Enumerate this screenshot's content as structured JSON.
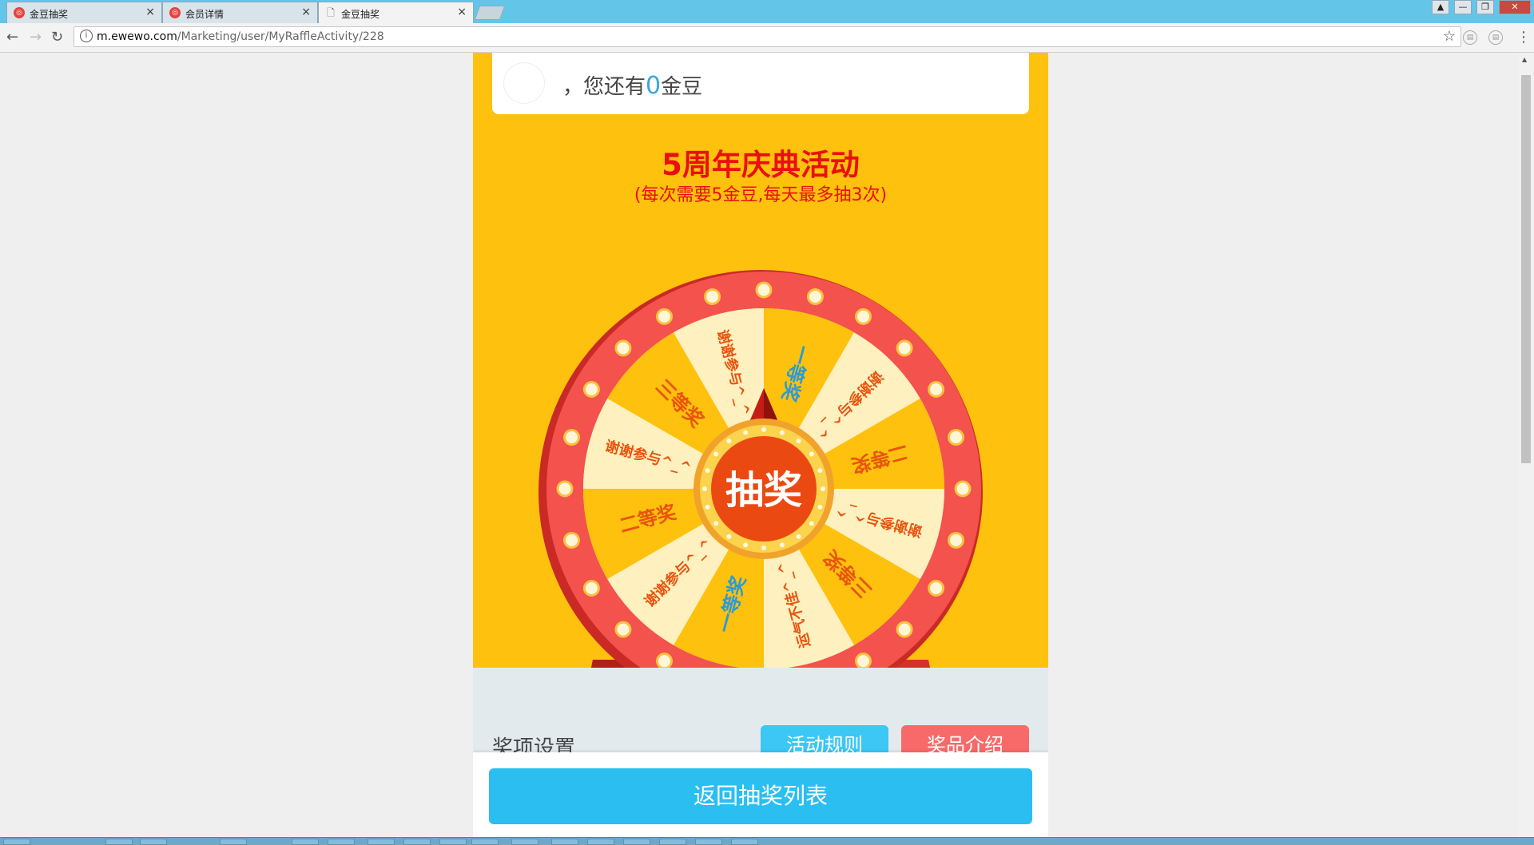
{
  "browser": {
    "tabs": [
      {
        "title": "金豆抽奖",
        "active": false
      },
      {
        "title": "会员详情",
        "active": false
      },
      {
        "title": "金豆抽奖",
        "active": true
      }
    ],
    "close_glyph": "×",
    "url_host": "m.ewewo.com",
    "url_path": "/Marketing/user/MyRaffleActivity/228"
  },
  "user": {
    "prefix": "，您还有",
    "beans": "0",
    "suffix": "金豆"
  },
  "activity": {
    "title": "5周年庆典活动",
    "subtitle": "(每次需要5金豆,每天最多抽3次)"
  },
  "wheel": {
    "center_label": "抽奖",
    "segments": [
      {
        "label": "一等奖",
        "color": "#2b9ad8"
      },
      {
        "label": "谢谢参与^_^",
        "color": "#e8540e"
      },
      {
        "label": "二等奖",
        "color": "#e8540e"
      },
      {
        "label": "谢谢参与^_^",
        "color": "#e8540e"
      },
      {
        "label": "三等奖",
        "color": "#e8540e"
      },
      {
        "label": "运气不佳^_^",
        "color": "#e8540e"
      },
      {
        "label": "一等奖",
        "color": "#2b9ad8"
      },
      {
        "label": "谢谢参与^_^",
        "color": "#e8540e"
      },
      {
        "label": "二等奖",
        "color": "#e8540e"
      },
      {
        "label": "谢谢参与^_^",
        "color": "#e8540e"
      },
      {
        "label": "三等奖",
        "color": "#e8540e"
      },
      {
        "label": "谢谢参与^_^",
        "color": "#e8540e"
      }
    ]
  },
  "sections": {
    "prize_settings": "奖项设置",
    "rules_button": "活动规则",
    "prizes_button": "奖品介绍"
  },
  "footer": {
    "back_button": "返回抽奖列表"
  },
  "colors": {
    "page_bg": "#fec10d",
    "title_red": "#e8100e",
    "rules_blue": "#3cc7f5",
    "prizes_red": "#f86a6a",
    "back_blue": "#2bbef0"
  }
}
